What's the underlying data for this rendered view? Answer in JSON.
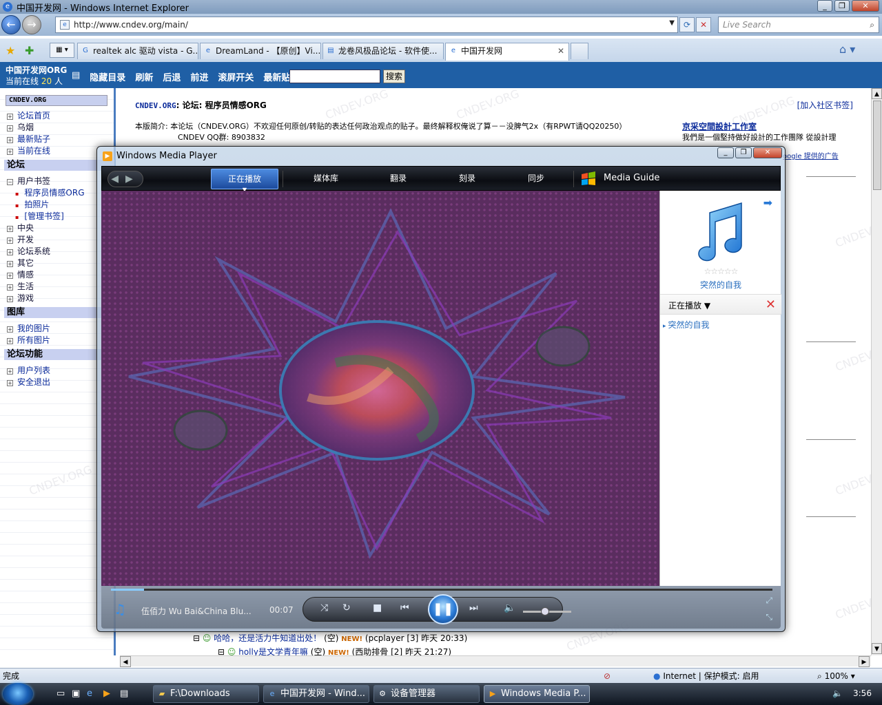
{
  "browser": {
    "title": "中国开发网 - Windows Internet Explorer",
    "address": "http://www.cndev.org/main/",
    "search_placeholder": "Live Search",
    "tabs": [
      {
        "label": "realtek alc 驱动 vista - G...",
        "icon": "G"
      },
      {
        "label": "DreamLand - 【原创】Vi...",
        "icon": "e"
      },
      {
        "label": "龙卷风极品论坛 - 软件使...",
        "icon": "doc"
      },
      {
        "label": "中国开发网",
        "icon": "e",
        "active": true
      }
    ],
    "status_left": "完成",
    "status_zone": "Internet | 保护模式: 启用",
    "status_zoom": "100%"
  },
  "forum_bar": {
    "site": "中国开发网ORG",
    "online_prefix": "当前在线",
    "online_count": "20",
    "online_suffix": "人",
    "menu": [
      "隐藏目录",
      "刷新",
      "后退",
      "前进",
      "滚屏开关",
      "最新贴子"
    ],
    "search_button": "搜索"
  },
  "sidebar": {
    "header": "CNDEV.ORG",
    "top_items": [
      "论坛首页",
      "乌烟",
      "最新贴子",
      "当前在线"
    ],
    "section_forum": "论坛",
    "bookmarks": "用户书签",
    "bookmark_items": [
      "程序员情感ORG",
      "拍照片",
      "[管理书签]"
    ],
    "forum_items": [
      "中央",
      "开发",
      "论坛系统",
      "其它",
      "情感",
      "生活",
      "游戏"
    ],
    "section_gallery": "图库",
    "gallery_items": [
      "我的图片",
      "所有图片"
    ],
    "section_functions": "论坛功能",
    "function_items": [
      "用户列表",
      "安全退出"
    ]
  },
  "content": {
    "crumb_org": "CNDEV.ORG",
    "crumb_forum": "论坛",
    "crumb_board": "程序员情感ORG",
    "add_bookmark": "[加入社区书签]",
    "intro_label": "本版简介:",
    "intro_text": "本论坛（CNDEV.ORG）不欢迎任何原创/转贴的表达任何政治观点的贴子。最终解释权俺说了算－－没脾气2x（有RPWT请QQ20250）",
    "qq_group": "CNDEV QQ群: 8903832",
    "ad_title": "京采空間設計工作室",
    "ad_line": "我們是一個堅持做好設計的工作團隊 從設計理",
    "ad_google": "oogle 提供的广告",
    "watermark": "CNDEV.ORG",
    "row1_title": "哈哈，还是活力牛知道出处！",
    "row1_meta": "(空)",
    "row1_user": "(pcplayer",
    "row1_rest": "[3] 昨天 20:33)",
    "row2_title": "holly是文学青年嘛",
    "row2_meta": "(空)",
    "row2_user": "(西助排骨",
    "row2_rest": "[2] 昨天 21:27)",
    "new_badge": "NEW!"
  },
  "wmp": {
    "title": "Windows Media Player",
    "tabs": [
      "正在播放",
      "媒体库",
      "翻录",
      "刻录",
      "同步",
      "Media Guide"
    ],
    "album_title": "突然的自我",
    "stars": "☆☆☆☆☆",
    "now_playing_label": "正在播放",
    "playlist": [
      "突然的自我"
    ],
    "track": "伍佰力 Wu Bai&China Blu...",
    "time": "00:07",
    "progress_fraction": 0.05,
    "volume_fraction": 0.45
  },
  "taskbar": {
    "buttons": [
      {
        "label": "F:\\Downloads",
        "icon": "folder"
      },
      {
        "label": "中国开发网 - Wind...",
        "icon": "ie"
      },
      {
        "label": "设备管理器",
        "icon": "devmgr"
      },
      {
        "label": "Windows Media P...",
        "icon": "wmp",
        "active": true
      }
    ],
    "clock": "3:56"
  },
  "colors": {
    "forum_bar": "#1f5fa5",
    "link": "#0a2a9a",
    "viz_bg": "#5a2d5f",
    "wmp_accent": "#2a7ad6"
  }
}
